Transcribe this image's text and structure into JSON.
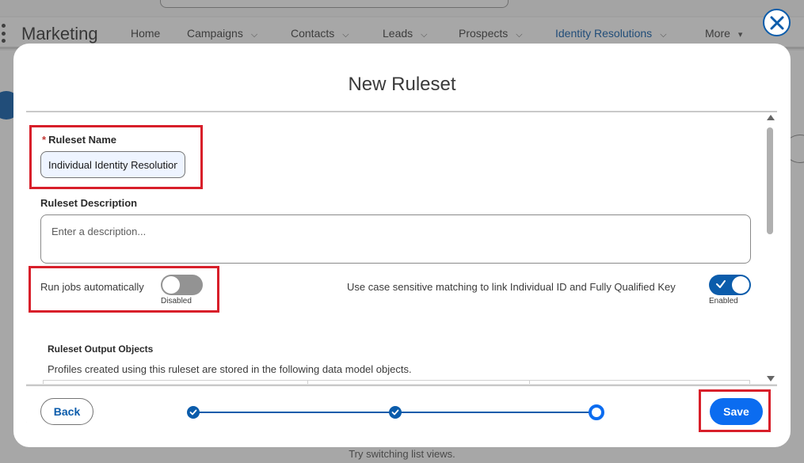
{
  "background": {
    "app_name": "Marketing",
    "nav": [
      {
        "label": "Home"
      },
      {
        "label": "Campaigns"
      },
      {
        "label": "Contacts"
      },
      {
        "label": "Leads"
      },
      {
        "label": "Prospects"
      },
      {
        "label": "Identity Resolutions"
      },
      {
        "label": "More"
      }
    ],
    "hint_text": "Try switching list views."
  },
  "modal": {
    "title": "New Ruleset",
    "ruleset_name": {
      "label": "Ruleset Name",
      "required_mark": "*",
      "value": "Individual Identity Resolution"
    },
    "ruleset_description": {
      "label": "Ruleset Description",
      "placeholder": "Enter a description..."
    },
    "run_jobs": {
      "label": "Run jobs automatically",
      "state_text": "Disabled",
      "enabled": false
    },
    "case_sensitive": {
      "label": "Use case sensitive matching to link Individual ID and Fully Qualified Key",
      "state_text": "Enabled",
      "enabled": true
    },
    "output_objects": {
      "title": "Ruleset Output Objects",
      "description": "Profiles created using this ruleset are stored in the following data model objects."
    },
    "footer": {
      "back_label": "Back",
      "save_label": "Save",
      "steps_total": 3,
      "current_step": 3
    }
  },
  "colors": {
    "brand": "#0b5cab",
    "primary_button": "#0b6cf0",
    "highlight": "#d81f2a"
  }
}
